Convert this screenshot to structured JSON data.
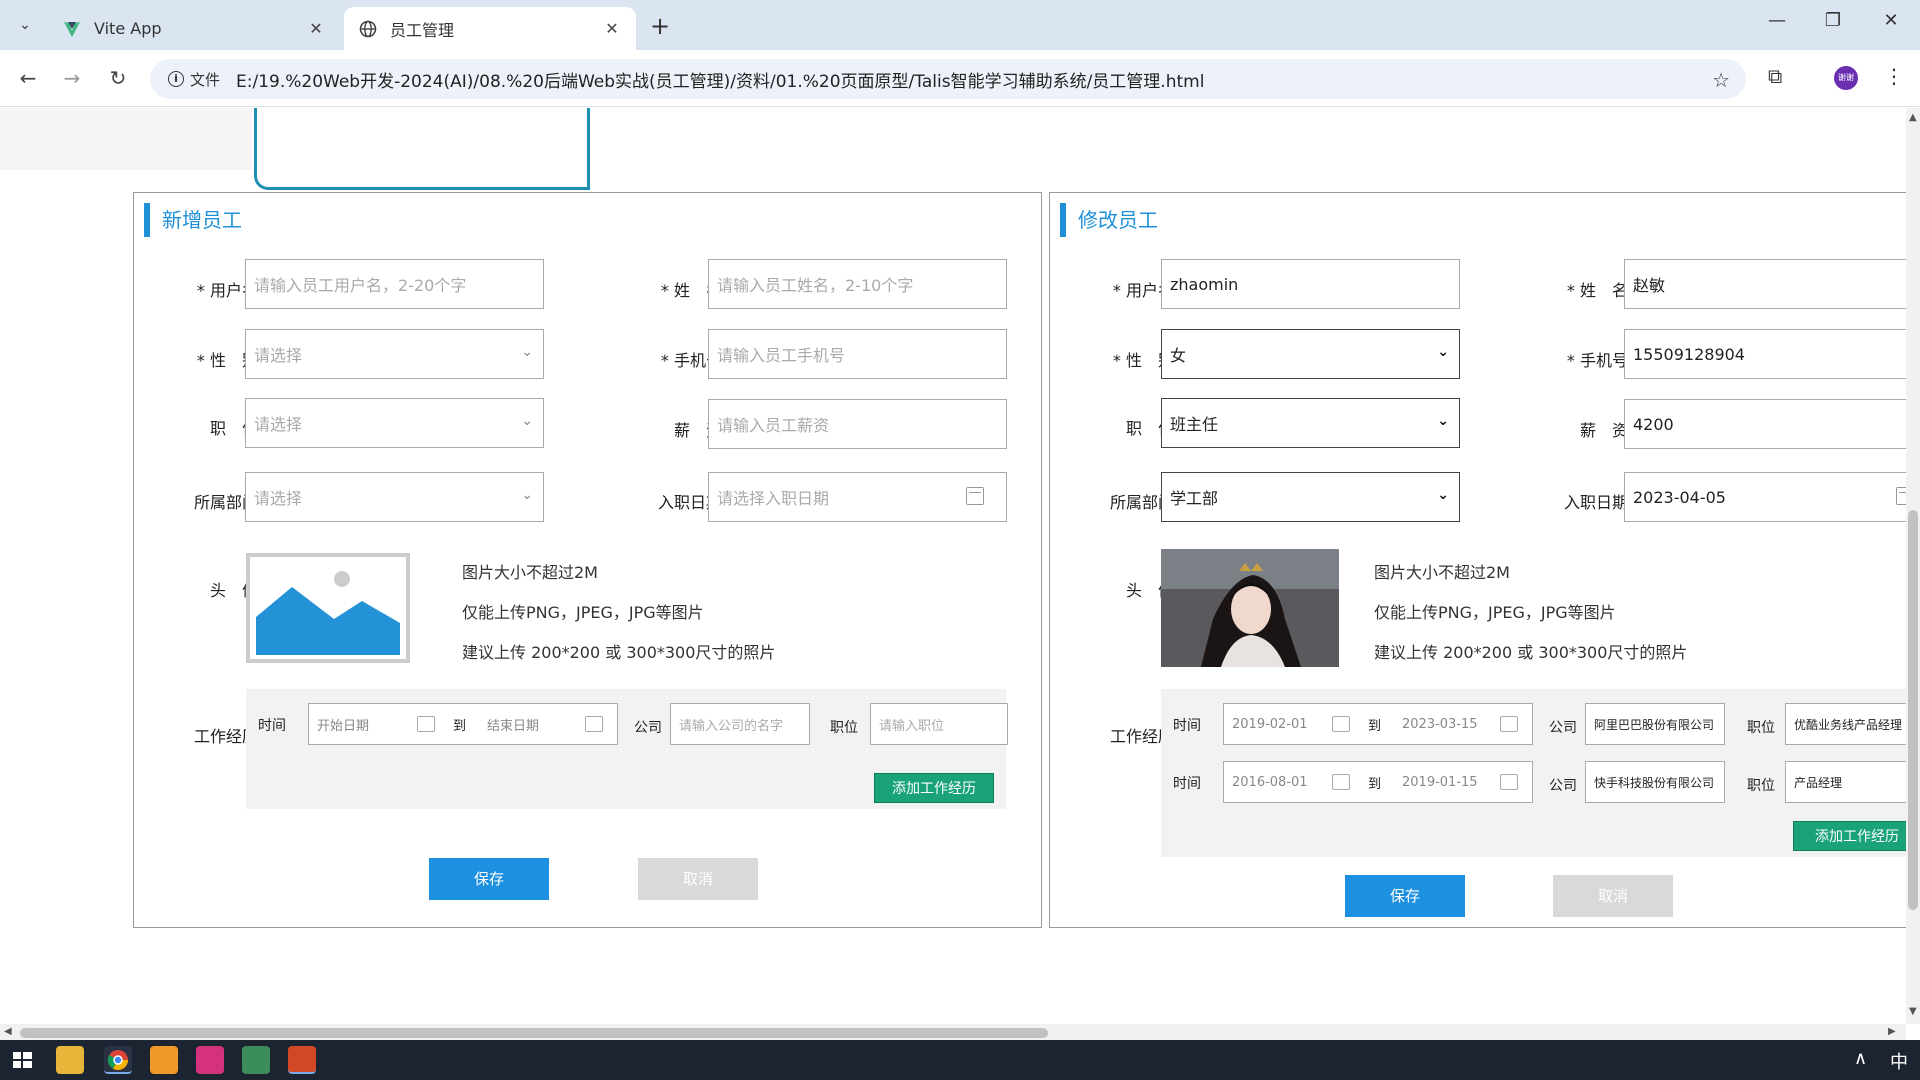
{
  "browser": {
    "tabs": [
      {
        "title": "Vite App",
        "icon": "vite-logo-icon",
        "active": false
      },
      {
        "title": "员工管理",
        "icon": "globe-icon",
        "active": true
      }
    ],
    "address_chip": "文件",
    "url": "E:/19.%20Web开发-2024(AI)/08.%20后端Web实战(员工管理)/资料/01.%20页面原型/Talis智能学习辅助系统/员工管理.html",
    "profile_initials": "谢谢"
  },
  "add_form": {
    "title": "新增员工",
    "username": {
      "label": "* 用户名",
      "placeholder": "请输入员工用户名，2-20个字"
    },
    "name": {
      "label": "* 姓　名",
      "placeholder": "请输入员工姓名，2-10个字"
    },
    "gender": {
      "label": "* 性　别",
      "placeholder": "请选择"
    },
    "phone": {
      "label": "* 手机号",
      "placeholder": "请输入员工手机号"
    },
    "position": {
      "label": "职　位",
      "placeholder": "请选择"
    },
    "salary": {
      "label": "薪　资",
      "placeholder": "请输入员工薪资"
    },
    "department": {
      "label": "所属部门",
      "placeholder": "请选择"
    },
    "entry_date": {
      "label": "入职日期",
      "placeholder": "请选择入职日期"
    },
    "avatar_label": "头　像",
    "hints": [
      "图片大小不超过2M",
      "仅能上传PNG，JPEG，JPG等图片",
      "建议上传 200*200 或 300*300尺寸的照片"
    ],
    "work_label": "工作经历",
    "work_row": {
      "time_label": "时间",
      "start_placeholder": "开始日期",
      "to_label": "到",
      "end_placeholder": "结束日期",
      "company_label": "公司",
      "company_placeholder": "请输入公司的名字",
      "position_label": "职位",
      "position_placeholder": "请输入职位"
    },
    "add_work_button": "添加工作经历",
    "save_button": "保存",
    "cancel_button": "取消"
  },
  "edit_form": {
    "title": "修改员工",
    "username": {
      "label": "* 用户名",
      "value": "zhaomin"
    },
    "name": {
      "label": "* 姓　名",
      "value": "赵敏"
    },
    "gender": {
      "label": "* 性　别",
      "value": "女"
    },
    "phone": {
      "label": "* 手机号",
      "value": "15509128904"
    },
    "position": {
      "label": "职　位",
      "value": "班主任"
    },
    "salary": {
      "label": "薪　资",
      "value": "4200"
    },
    "department": {
      "label": "所属部门",
      "value": "学工部"
    },
    "entry_date": {
      "label": "入职日期",
      "value": "2023-04-05"
    },
    "avatar_label": "头　像",
    "hints": [
      "图片大小不超过2M",
      "仅能上传PNG，JPEG，JPG等图片",
      "建议上传 200*200 或 300*300尺寸的照片"
    ],
    "work_label": "工作经历",
    "time_label": "时间",
    "to_label": "到",
    "company_label": "公司",
    "position_label": "职位",
    "work_rows": [
      {
        "start": "2019-02-01",
        "end": "2023-03-15",
        "company": "阿里巴巴股份有限公司",
        "position": "优酷业务线产品经理"
      },
      {
        "start": "2016-08-01",
        "end": "2019-01-15",
        "company": "快手科技股份有限公司",
        "position": "产品经理"
      }
    ],
    "add_work_button": "添加工作经历",
    "save_button": "保存",
    "cancel_button": "取消"
  },
  "taskbar": {
    "ime": "中"
  }
}
